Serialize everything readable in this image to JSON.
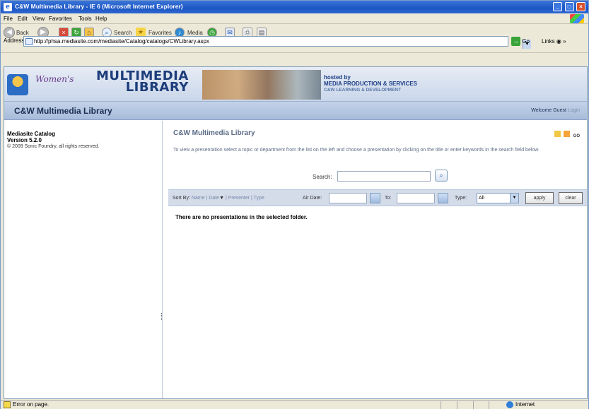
{
  "window": {
    "title": "C&W Multimedia Library - IE 6 (Microsoft Internet Explorer)"
  },
  "menu": [
    "File",
    "Edit",
    "View",
    "Favorites",
    "Tools",
    "Help"
  ],
  "toolbar": {
    "back": "Back",
    "search": "Search",
    "favorites": "Favorites",
    "media": "Media"
  },
  "address": {
    "label": "Address",
    "url": "http://phsa.mediasite.com/mediasite/Catalog/catalogs/CWLibrary.aspx",
    "go": "Go",
    "links": "Links"
  },
  "banner": {
    "title_line1": "MULTIMEDIA",
    "title_line2": "LIBRARY",
    "hosted_by": "hosted by",
    "org": "MEDIA PRODUCTION & SERVICES",
    "sub_org": "C&W LEARNING & DEVELOPMENT"
  },
  "header": {
    "app_title": "C&W Multimedia Library",
    "welcome": "Welcome Guest",
    "login": "Login"
  },
  "sidebar": {
    "catalog_name": "Mediasite Catalog",
    "version": "Version 5.2.0",
    "copyright": "© 2009 Sonic Foundry, all rights reserved."
  },
  "content": {
    "title": "C&W Multimedia Library",
    "icon_go": "GO",
    "description": "To view a presentation select a topic or department from the list on the left and choose a presentation by clicking on the title or enter keywords in the search field below.",
    "search_label": "Search:",
    "search_value": "",
    "sort_label": "Sort By:",
    "sort_options": [
      "Name",
      "Date",
      "Presenter",
      "Type"
    ],
    "air_date_label": "Air Date:",
    "to_label": "To:",
    "type_label": "Type:",
    "type_value": "All",
    "apply": "apply",
    "clear": "clear",
    "empty_message": "There are no presentations in the selected folder."
  },
  "status": {
    "left": "Error on page.",
    "zone": "Internet"
  }
}
